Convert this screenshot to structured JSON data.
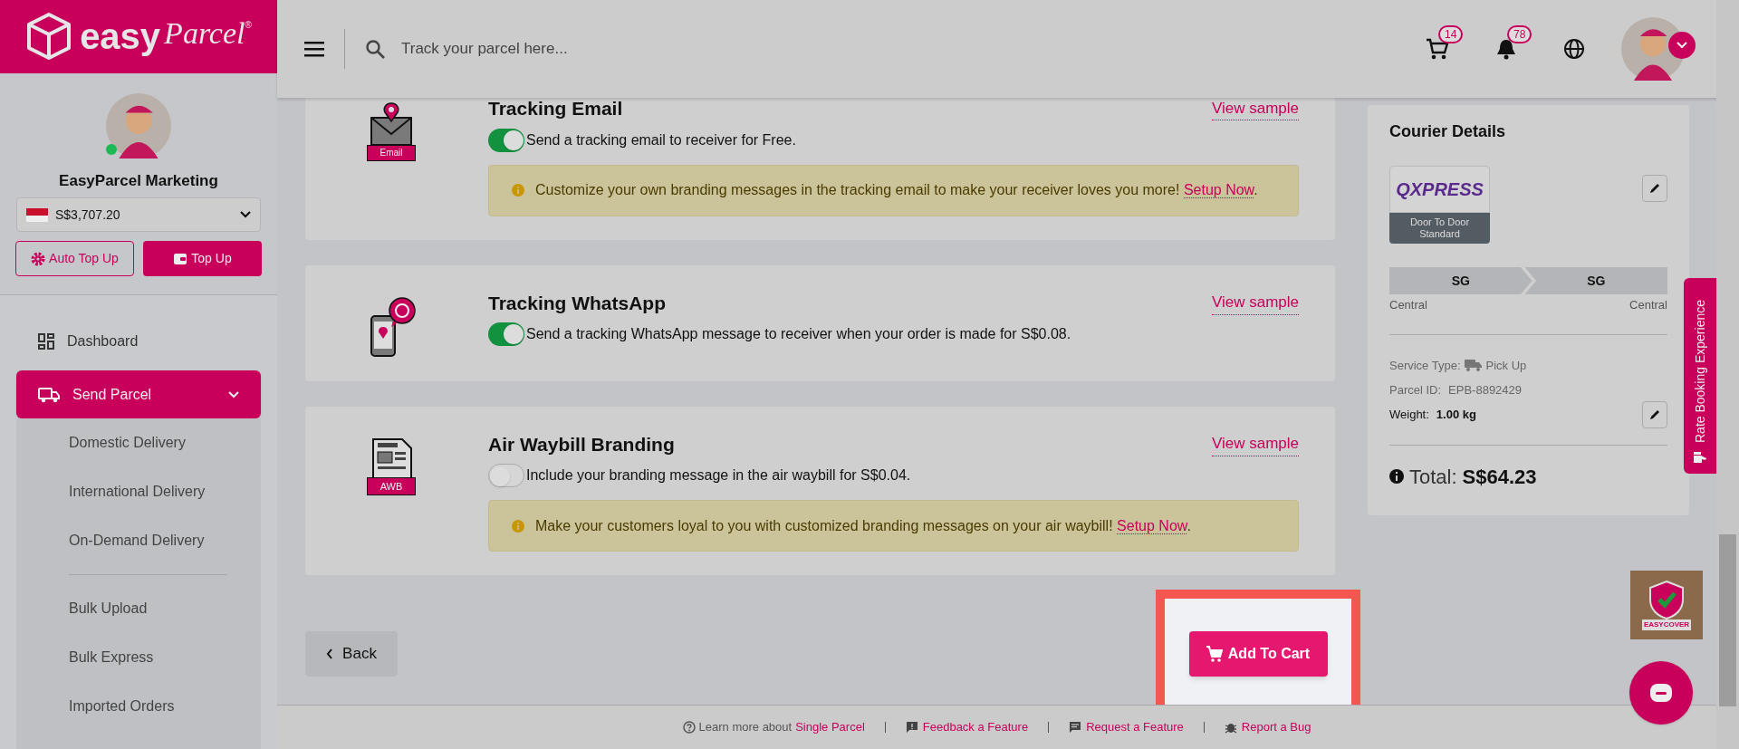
{
  "brand": {
    "name_a": "easy",
    "name_b": "Parcel",
    "mark": "®"
  },
  "header": {
    "search_placeholder": "Track your parcel here...",
    "cart_count": "14",
    "notification_count": "78"
  },
  "profile": {
    "name": "EasyParcel Marketing",
    "online": true,
    "balance": "S$3,707.20",
    "auto_top_up": "Auto Top Up",
    "top_up": "Top Up"
  },
  "nav": [
    {
      "label": "Dashboard",
      "selected": false
    },
    {
      "label": "Send Parcel",
      "selected": true,
      "expanded": true,
      "sections": [
        [
          {
            "label": "Domestic Delivery"
          },
          {
            "label": "International Delivery"
          },
          {
            "label": "On-Demand Delivery"
          }
        ],
        [
          {
            "label": "Bulk Upload"
          },
          {
            "label": "Bulk Express"
          },
          {
            "label": "Imported Orders"
          }
        ]
      ]
    }
  ],
  "add_ons": [
    {
      "kind": "email",
      "icon_label": "Email",
      "title": "Tracking Email",
      "link": "View sample",
      "on": true,
      "description": "Send a tracking email to receiver for Free.",
      "notice": {
        "text": "Customize your own branding messages in the tracking email to make your receiver loves you more! ",
        "link": "Setup Now",
        "after": "."
      }
    },
    {
      "kind": "whatsapp",
      "title": "Tracking WhatsApp",
      "link": "View sample",
      "on": true,
      "description": "Send a tracking WhatsApp message to receiver when your order is made for S$0.08."
    },
    {
      "kind": "awb",
      "icon_label": "AWB",
      "title": "Air Waybill Branding",
      "link": "View sample",
      "on": false,
      "description": "Include your branding message in the air waybill for S$0.04.",
      "notice": {
        "text": "Make your customers loyal to you with customized branding messages on your air waybill! ",
        "link": "Setup Now",
        "after": "."
      }
    }
  ],
  "actions": {
    "back": "Back",
    "add_to_cart": "Add To Cart"
  },
  "courier": {
    "title": "Courier Details",
    "logo": "QXPRESS",
    "service": "Door To Door Standard",
    "from": {
      "code": "SG",
      "area": "Central"
    },
    "to": {
      "code": "SG",
      "area": "Central"
    },
    "service_type_label": "Service Type:",
    "service_type": "Pick Up",
    "parcel_id_label": "Parcel ID:",
    "parcel_id": "EPB-8892429",
    "weight_label": "Weight:",
    "weight": "1.00 kg",
    "total_label": "Total:",
    "total": "S$64.23"
  },
  "rate_tab": "Rate Booking Experience",
  "easycover": "EASYCOVER",
  "footer": {
    "learn_prefix": "Learn more about",
    "learn_link": "Single Parcel",
    "links": [
      {
        "kind": "feedback",
        "label": "Feedback a Feature"
      },
      {
        "kind": "request",
        "label": "Request a Feature"
      },
      {
        "kind": "bug",
        "label": "Report a Bug"
      }
    ]
  }
}
